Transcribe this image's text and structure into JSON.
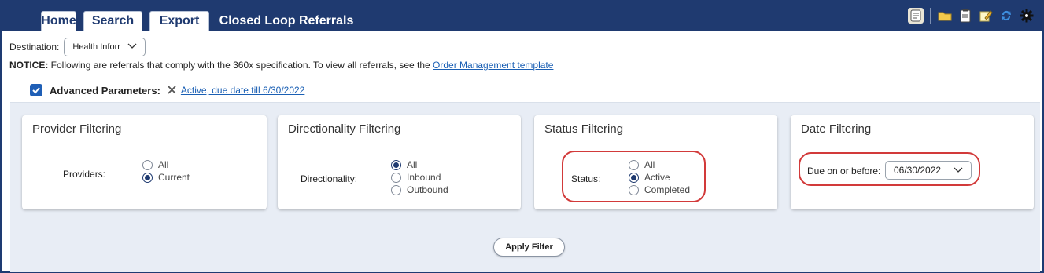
{
  "tabs": [
    {
      "label": "Home",
      "active": false
    },
    {
      "label": "Search",
      "active": false
    },
    {
      "label": "Export",
      "active": false
    },
    {
      "label": "Closed Loop Referrals",
      "active": true
    }
  ],
  "toolbar": {
    "icons": [
      "notes-icon",
      "folder-icon",
      "clipboard-icon",
      "edit-icon",
      "refresh-icon",
      "gear-icon"
    ]
  },
  "destination": {
    "label": "Destination:",
    "value": "Health Inforr"
  },
  "notice": {
    "bold": "NOTICE:",
    "text": " Following are referrals that comply with the 360x specification. To view all referrals, see the ",
    "link": "Order Management template"
  },
  "advanced": {
    "checked": true,
    "label": "Advanced Parameters:",
    "summary_link": "Active, due date till 6/30/2022"
  },
  "cards": {
    "provider": {
      "title": "Provider Filtering",
      "field_label": "Providers:",
      "options": [
        {
          "label": "All",
          "selected": false
        },
        {
          "label": "Current",
          "selected": true
        }
      ]
    },
    "directionality": {
      "title": "Directionality Filtering",
      "field_label": "Directionality:",
      "options": [
        {
          "label": "All",
          "selected": true
        },
        {
          "label": "Inbound",
          "selected": false
        },
        {
          "label": "Outbound",
          "selected": false
        }
      ]
    },
    "status": {
      "title": "Status Filtering",
      "field_label": "Status:",
      "options": [
        {
          "label": "All",
          "selected": false
        },
        {
          "label": "Active",
          "selected": true
        },
        {
          "label": "Completed",
          "selected": false
        }
      ]
    },
    "date": {
      "title": "Date Filtering",
      "field_label": "Due on or before:",
      "value": "06/30/2022"
    }
  },
  "apply_button": "Apply Filter",
  "colors": {
    "header": "#1f3a70",
    "highlight": "#d23a3a",
    "link": "#1a5fb4"
  }
}
